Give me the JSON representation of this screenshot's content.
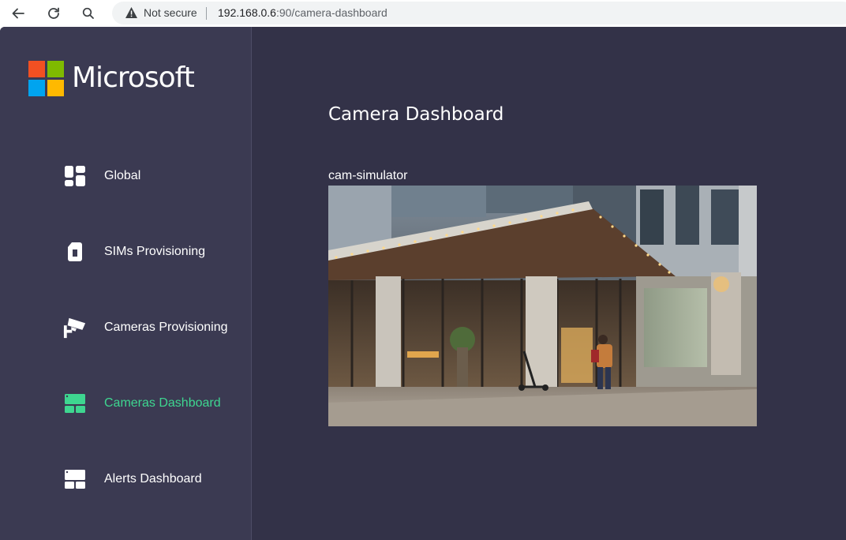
{
  "browser": {
    "security_label": "Not secure",
    "url_host": "192.168.0.6",
    "url_rest": ":90/camera-dashboard"
  },
  "logo": {
    "text": "Microsoft",
    "colors": [
      "#f25022",
      "#7fba00",
      "#00a4ef",
      "#ffb900"
    ]
  },
  "sidebar": {
    "items": [
      {
        "label": "Global",
        "icon": "dashboard-tiles-icon",
        "active": false
      },
      {
        "label": "SIMs Provisioning",
        "icon": "sim-card-icon",
        "active": false
      },
      {
        "label": "Cameras Provisioning",
        "icon": "security-camera-icon",
        "active": false
      },
      {
        "label": "Cameras Dashboard",
        "icon": "camera-dashboard-icon",
        "active": true
      },
      {
        "label": "Alerts Dashboard",
        "icon": "alerts-dashboard-icon",
        "active": false
      }
    ]
  },
  "main": {
    "title": "Camera Dashboard",
    "cameras": [
      {
        "name": "cam-simulator"
      }
    ]
  },
  "colors": {
    "background": "#333248",
    "sidebar": "#3b3a52",
    "accent": "#3ed690"
  }
}
